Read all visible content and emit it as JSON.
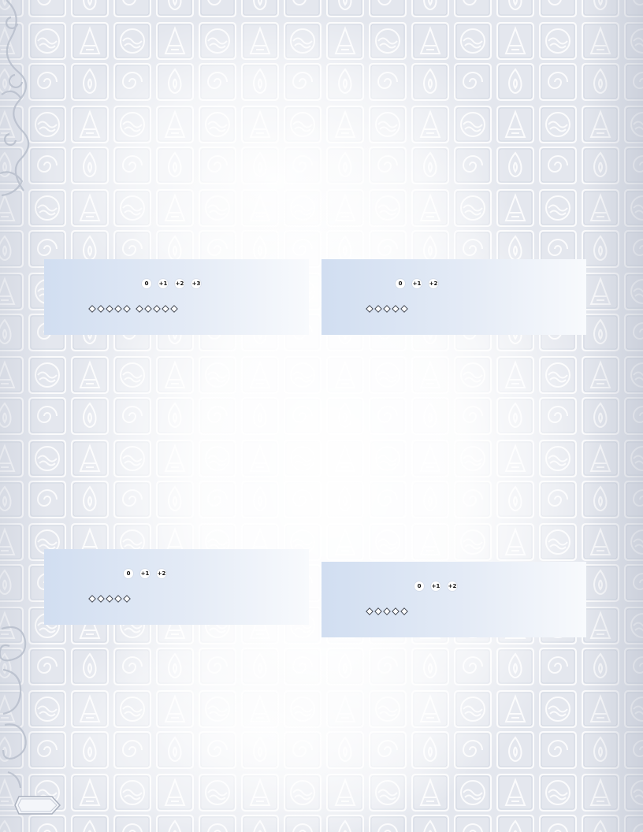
{
  "panels": [
    {
      "pips": [
        "0",
        "+1",
        "+2",
        "+3"
      ],
      "diamond_groups": [
        5,
        5
      ]
    },
    {
      "pips": [
        "0",
        "+1",
        "+2"
      ],
      "diamond_groups": [
        5
      ]
    },
    {
      "pips": [
        "0",
        "+1",
        "+2"
      ],
      "diamond_groups": [
        5
      ]
    },
    {
      "pips": [
        "0",
        "+1",
        "+2"
      ],
      "diamond_groups": [
        5
      ]
    }
  ],
  "colors": {
    "panel_start": "#d1def1",
    "panel_end": "#f8fafd",
    "diamond_stroke": "#3a3f4a"
  },
  "icons": [
    "water-tribe-emblem",
    "earth-kingdom-emblem",
    "air-nomad-emblem",
    "fire-nation-emblem"
  ]
}
